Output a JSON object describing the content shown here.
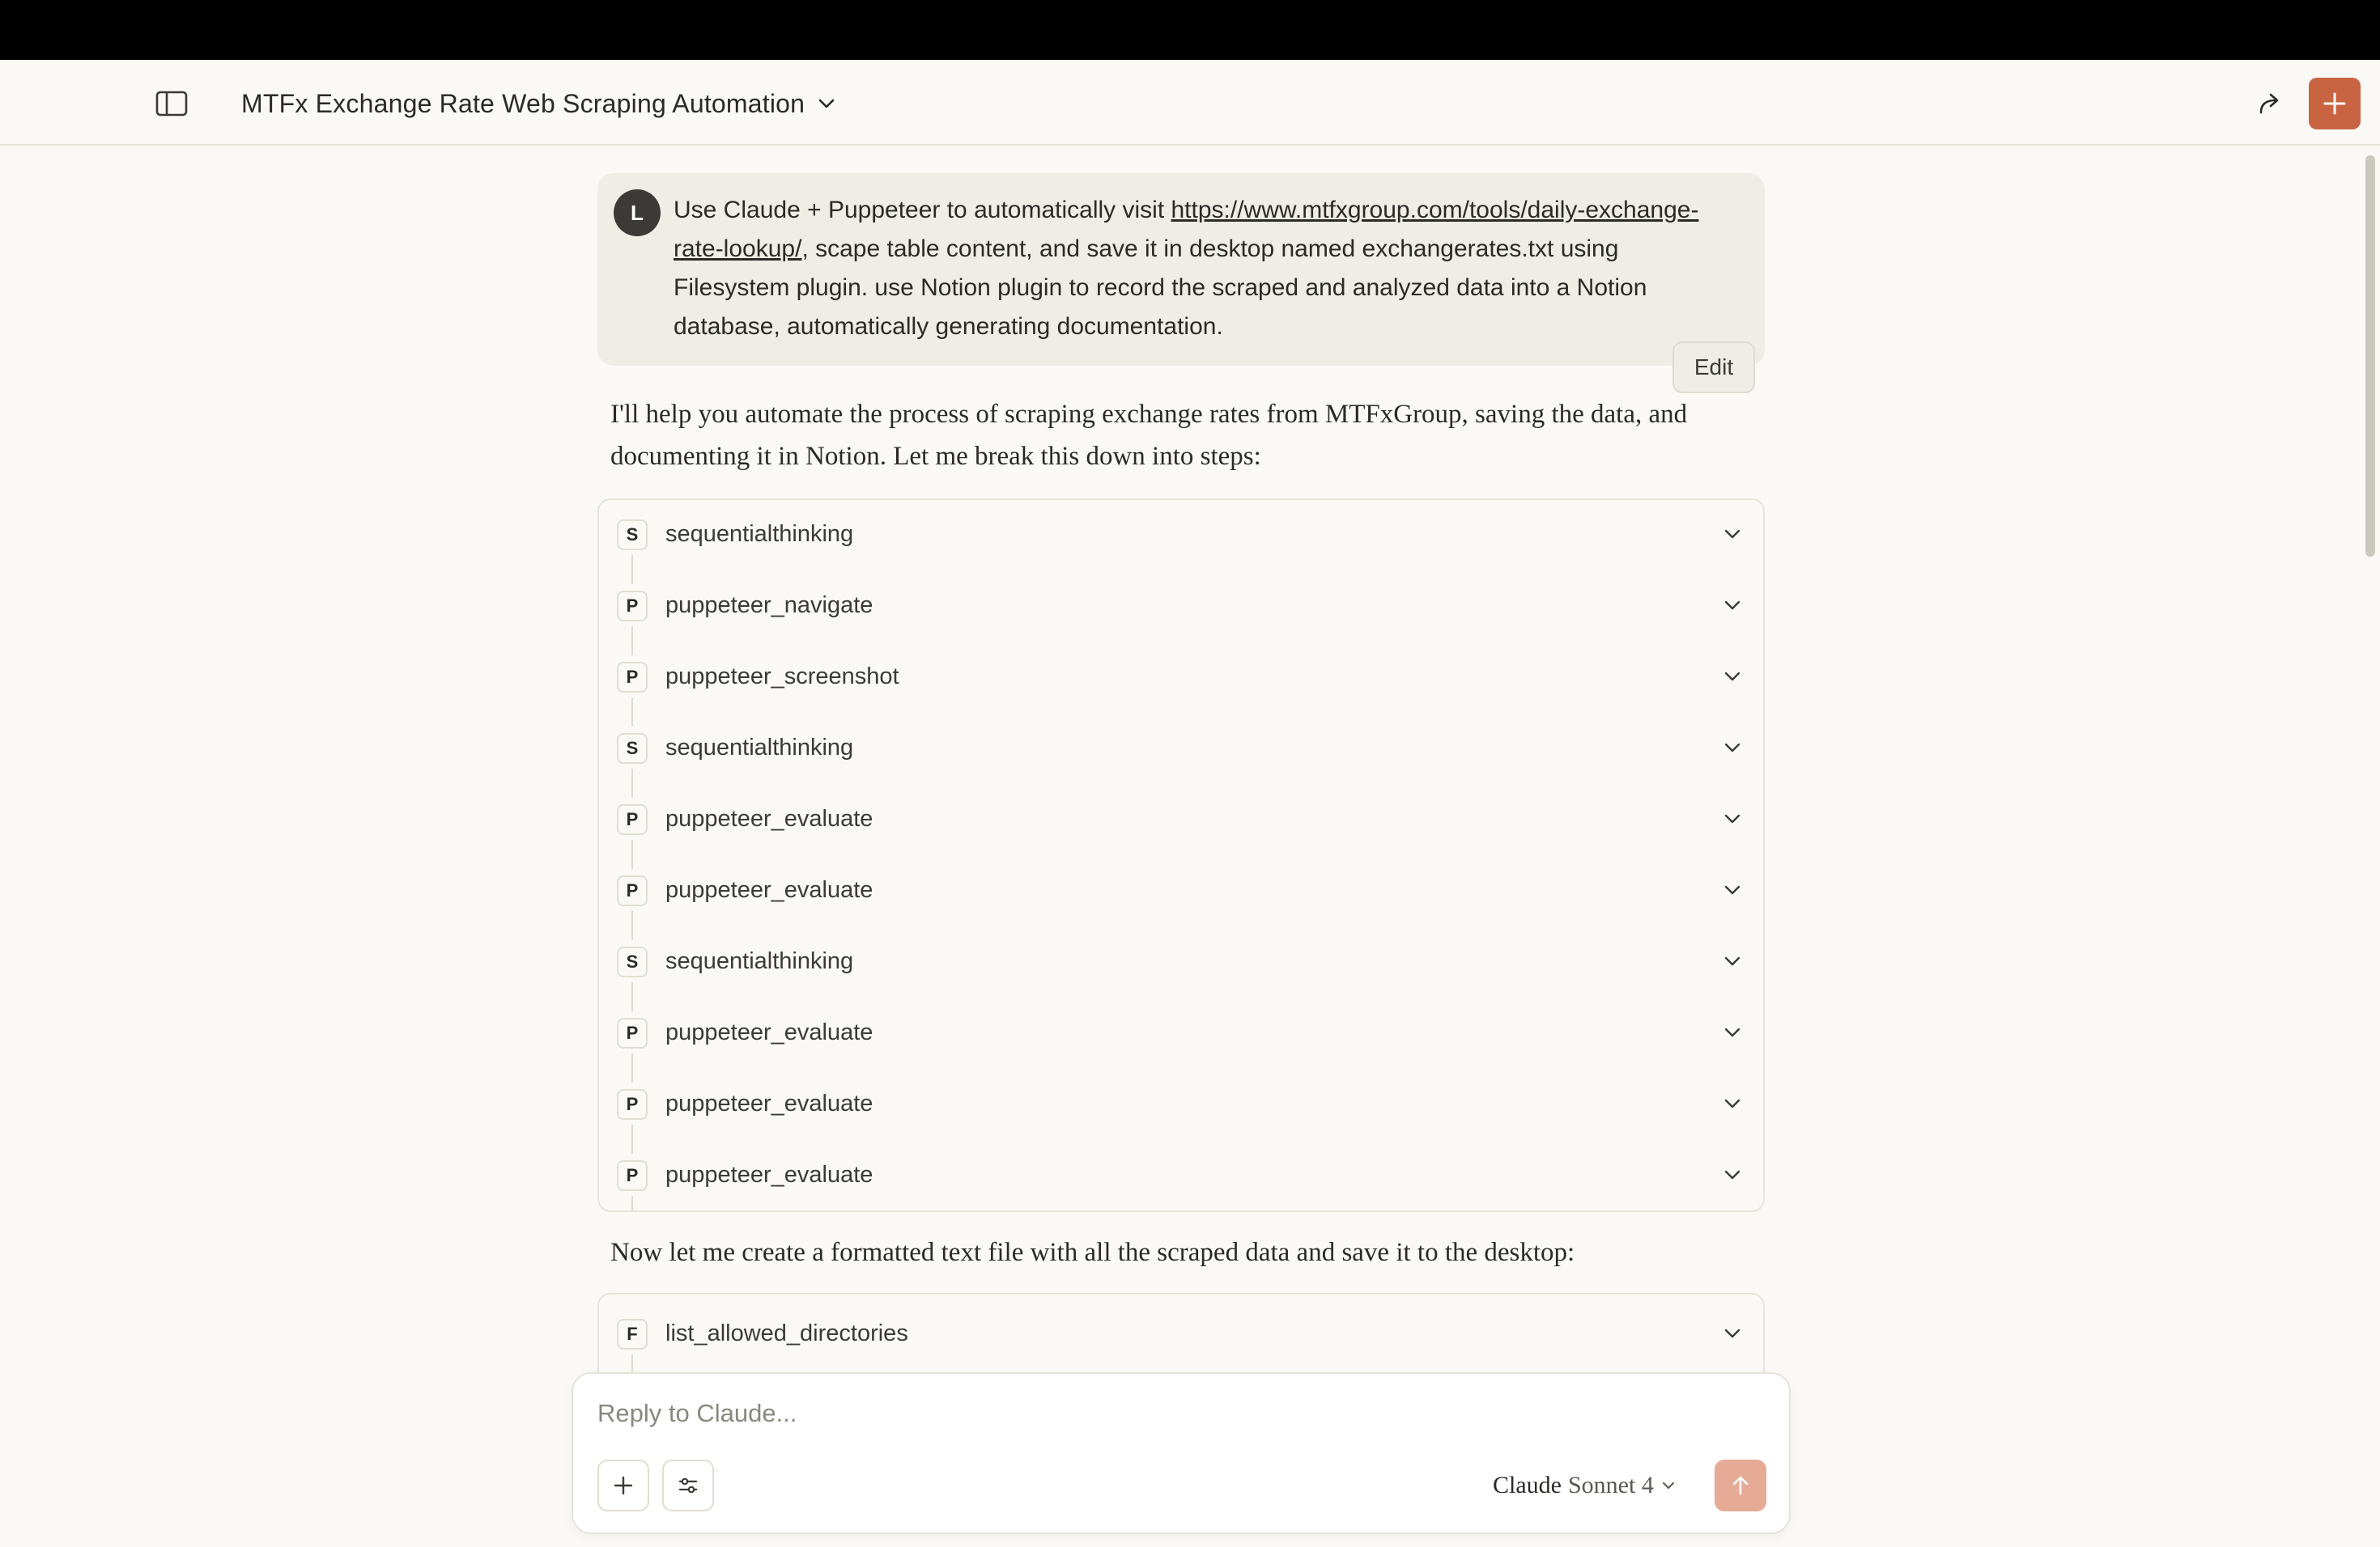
{
  "header": {
    "title": "MTFx Exchange Rate Web Scraping Automation"
  },
  "user_message": {
    "avatar_initial": "L",
    "text_before_link": "Use Claude + Puppeteer to automatically visit ",
    "link_text": "https://www.mtfxgroup.com/tools/daily-exchange-rate-lookup/",
    "text_after_link": ", scape table content, and save it in desktop named exchangerates.txt using Filesystem plugin. use Notion plugin to record the scraped and analyzed data into a Notion database, automatically generating documentation.",
    "edit_label": "Edit"
  },
  "assistant": {
    "intro_text": "I'll help you automate the process of scraping exchange rates from MTFxGroup, saving the data, and documenting it in Notion. Let me break this down into steps:",
    "tool_calls_1": [
      {
        "badge": "S",
        "name": "sequentialthinking"
      },
      {
        "badge": "P",
        "name": "puppeteer_navigate"
      },
      {
        "badge": "P",
        "name": "puppeteer_screenshot"
      },
      {
        "badge": "S",
        "name": "sequentialthinking"
      },
      {
        "badge": "P",
        "name": "puppeteer_evaluate"
      },
      {
        "badge": "P",
        "name": "puppeteer_evaluate"
      },
      {
        "badge": "S",
        "name": "sequentialthinking"
      },
      {
        "badge": "P",
        "name": "puppeteer_evaluate"
      },
      {
        "badge": "P",
        "name": "puppeteer_evaluate"
      },
      {
        "badge": "P",
        "name": "puppeteer_evaluate"
      }
    ],
    "followup_text": "Now let me create a formatted text file with all the scraped data and save it to the desktop:",
    "tool_calls_2": [
      {
        "badge": "F",
        "name": "list_allowed_directories"
      }
    ]
  },
  "composer": {
    "placeholder": "Reply to Claude...",
    "model_name": "Claude",
    "model_version": "Sonnet 4"
  },
  "colors": {
    "accent": "#c96442",
    "send_disabled": "#e6ab97",
    "background": "#faf9f5"
  },
  "icons": {
    "sidebar_toggle": "sidebar-panel-icon",
    "title_dropdown": "chevron-down-icon",
    "share": "share-arrow-icon",
    "new_chat": "plus-icon",
    "attach": "plus-icon",
    "tools": "sliders-icon",
    "send": "arrow-up-icon"
  }
}
